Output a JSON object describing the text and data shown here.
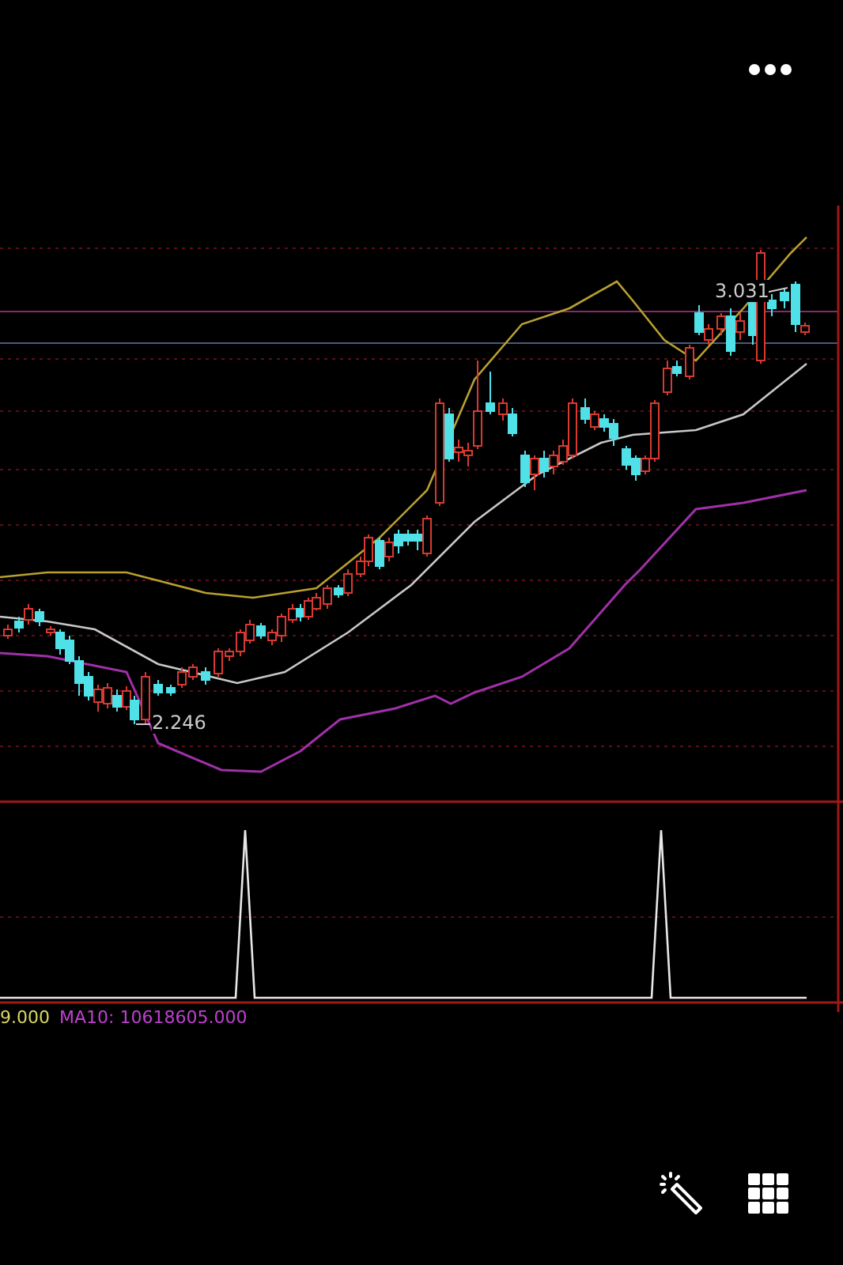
{
  "price_chart": {
    "high_label": "3.031",
    "low_label": "2.246"
  },
  "volume_legend": {
    "value": "9.000",
    "ma10": "MA10: 10618605.000"
  }
}
